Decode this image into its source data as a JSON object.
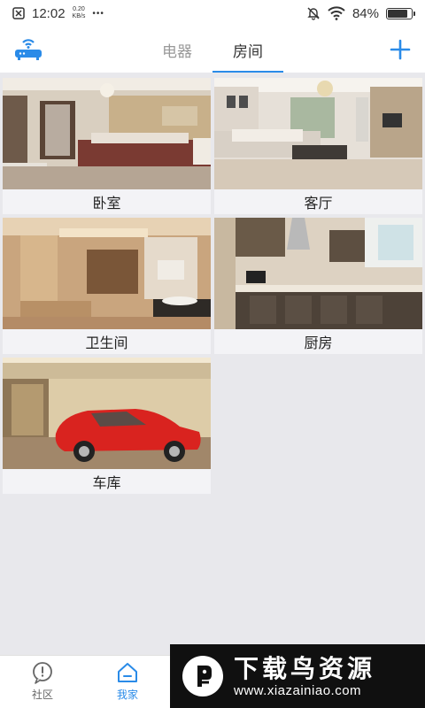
{
  "status_bar": {
    "time": "12:02",
    "net_speed_value": "0.20",
    "net_speed_unit": "KB/s",
    "more": "•••",
    "battery": "84%",
    "battery_level": 0.84
  },
  "header": {
    "tabs": [
      {
        "label": "电器",
        "active": false
      },
      {
        "label": "房间",
        "active": true
      }
    ],
    "accent_color": "#2a8be8"
  },
  "rooms": [
    {
      "name": "卧室",
      "image": "bedroom"
    },
    {
      "name": "客厅",
      "image": "living-room"
    },
    {
      "name": "卫生间",
      "image": "bathroom"
    },
    {
      "name": "厨房",
      "image": "kitchen"
    },
    {
      "name": "车库",
      "image": "garage"
    }
  ],
  "bottom_nav": {
    "items": [
      {
        "label": "社区",
        "icon": "community-icon",
        "active": false
      },
      {
        "label": "我家",
        "icon": "home-icon",
        "active": true
      }
    ]
  },
  "watermark": {
    "title": "下载鸟资源",
    "url": "www.xiazainiao.com"
  }
}
